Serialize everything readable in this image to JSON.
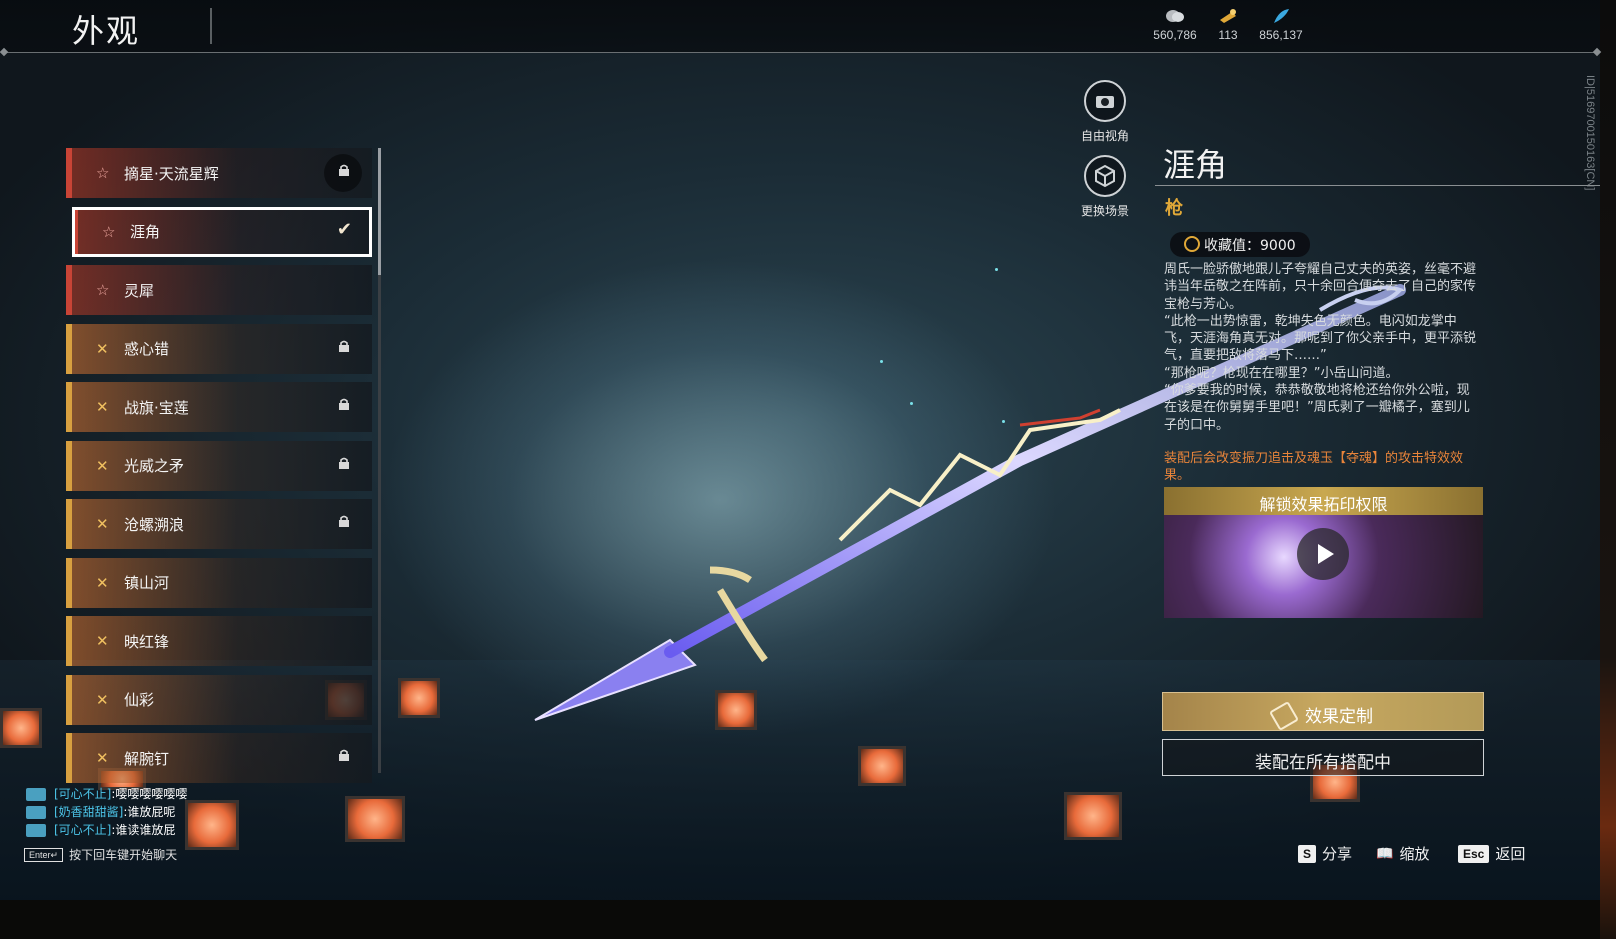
{
  "header": {
    "title": "外观",
    "currencies": [
      {
        "icon": "coin-stack-icon",
        "value": "560,786"
      },
      {
        "icon": "gold-ticket-icon",
        "value": "113"
      },
      {
        "icon": "blue-feather-icon",
        "value": "856,137"
      }
    ]
  },
  "player_id": "ID|516970015016​3[CN]",
  "list": [
    {
      "label": "摘星·天流星辉",
      "tier": "red",
      "locked": true,
      "selected": false
    },
    {
      "label": "涯角",
      "tier": "red",
      "locked": false,
      "selected": true
    },
    {
      "label": "灵犀",
      "tier": "red",
      "locked": false,
      "selected": false
    },
    {
      "label": "惑心错",
      "tier": "gold",
      "locked": true,
      "selected": false
    },
    {
      "label": "战旗·宝莲",
      "tier": "gold",
      "locked": true,
      "selected": false
    },
    {
      "label": "光威之矛",
      "tier": "gold",
      "locked": true,
      "selected": false
    },
    {
      "label": "沧螺溯浪",
      "tier": "gold",
      "locked": true,
      "selected": false
    },
    {
      "label": "镇山河",
      "tier": "gold",
      "locked": false,
      "selected": false
    },
    {
      "label": "映红锋",
      "tier": "gold",
      "locked": false,
      "selected": false
    },
    {
      "label": "仙彩",
      "tier": "gold",
      "locked": false,
      "selected": false
    },
    {
      "label": "解腕钉",
      "tier": "gold",
      "locked": true,
      "selected": false
    }
  ],
  "camera": {
    "free_view": "自由视角",
    "change_scene": "更换场景"
  },
  "detail": {
    "name": "涯角",
    "type": "枪",
    "collection": "收藏值：9000",
    "description": [
      "周氏一脸骄傲地跟儿子夸耀自己丈夫的英姿，丝毫不避讳当年岳敬之在阵前，只十余回合便夺去了自己的家传宝枪与芳心。",
      "“此枪一出势惊雷，乾坤失色无颜色。电闪如龙掌中飞，天涯海角真无对。那呢到了你父亲手中，更平添锐气，直要把敌将落马下……”",
      "“那枪呢？枪现在在哪里？”小岳山问道。",
      "“你爹要我的时候，恭恭敬敬地将枪还给你外公啦，现在该是在你舅舅手里吧！”周氏剥了一瓣橘子，塞到儿子的口中。"
    ],
    "effect_note": "装配后会改变振刀追击及魂玉【夺魂】的攻击特效效果。",
    "video_title": "解锁效果拓印权限",
    "custom_button": "效果定制",
    "equip_button": "装配在所有搭配中"
  },
  "chat": {
    "messages": [
      {
        "name": "[可心不止]",
        "text": ":嘤嘤嘤嘤嘤嘤"
      },
      {
        "name": "[奶香甜甜酱]",
        "text": ":谁放屁呢"
      },
      {
        "name": "[可心不止]",
        "text": ":谁读谁放屁"
      }
    ],
    "enter_key": "Enter↵",
    "hint": "按下回车键开始聊天"
  },
  "keys": [
    {
      "key": "S",
      "label": "分享"
    },
    {
      "key": "📖",
      "label": "缩放"
    },
    {
      "key": "Esc",
      "label": "返回"
    }
  ]
}
